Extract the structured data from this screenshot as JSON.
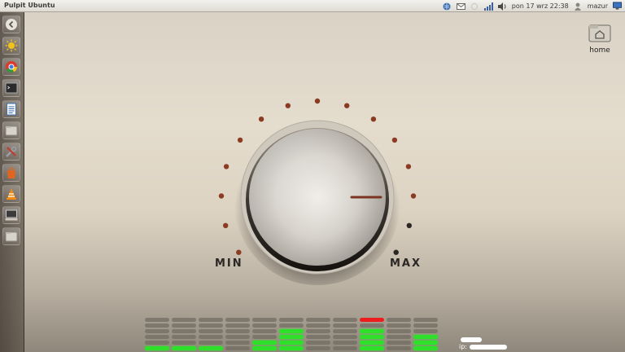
{
  "window_title": "Pulpit Ubuntu",
  "tray": {
    "datetime": "pon 17 wrz 22:38",
    "user": "mazur",
    "icons": [
      "network-icon",
      "mail-icon",
      "bluetooth-icon",
      "signal-icon",
      "volume-icon",
      "user-icon",
      "power-icon"
    ]
  },
  "launcher": {
    "items": [
      "dash-home-icon",
      "weather-icon",
      "chrome-icon",
      "terminal-icon",
      "text-editor-icon",
      "folder-icon",
      "tools-icon",
      "software-center-icon",
      "vlc-icon",
      "workspace-icon",
      "folder2-icon"
    ]
  },
  "desktop": {
    "home_label": "home"
  },
  "knob": {
    "min_label": "MIN",
    "max_label": "MAX",
    "dots_total": 15,
    "dots_lit": 13
  },
  "equalizer": {
    "columns": [
      {
        "lit": 1,
        "red": false
      },
      {
        "lit": 1,
        "red": false
      },
      {
        "lit": 1,
        "red": false
      },
      {
        "lit": 0,
        "red": false
      },
      {
        "lit": 2,
        "red": false
      },
      {
        "lit": 4,
        "red": false
      },
      {
        "lit": 0,
        "red": false
      },
      {
        "lit": 0,
        "red": false
      },
      {
        "lit": 4,
        "red": true
      },
      {
        "lit": 0,
        "red": false
      },
      {
        "lit": 3,
        "red": false
      }
    ],
    "segments_per_column": 6
  },
  "ip_prefix": "ip:"
}
